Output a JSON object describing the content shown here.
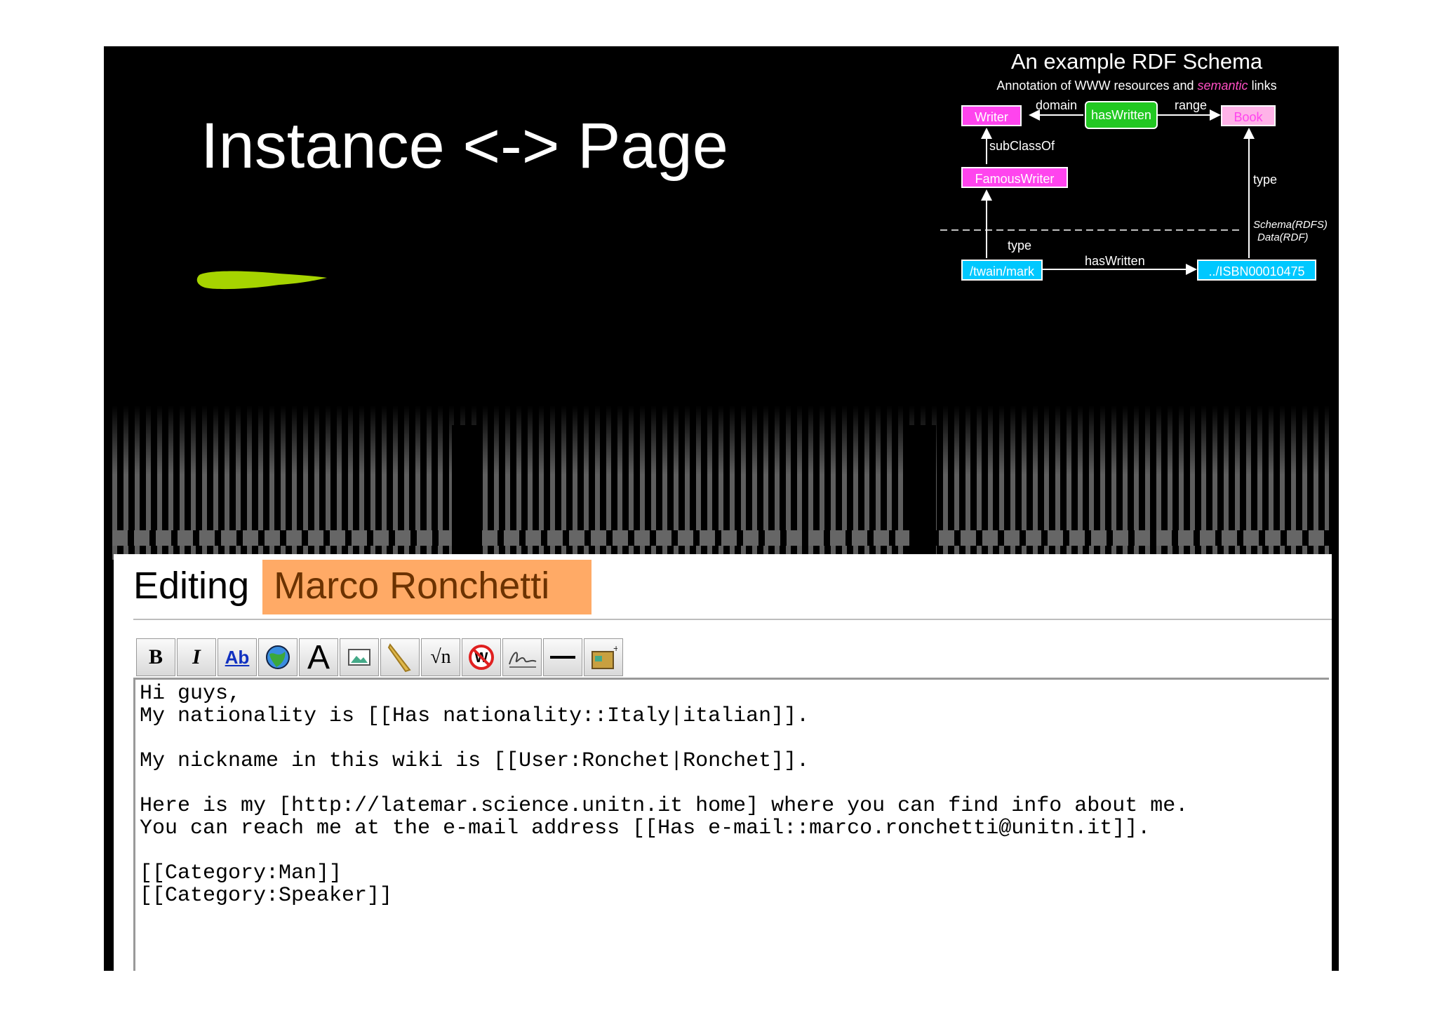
{
  "slide": {
    "title": "Instance <-> Page"
  },
  "rdf": {
    "title": "An example RDF Schema",
    "subtitle_prefix": "Annotation of WWW resources and ",
    "subtitle_semantic": "semantic",
    "subtitle_suffix": " links",
    "nodes": {
      "writer": "Writer",
      "haswritten_prop": "hasWritten",
      "book": "Book",
      "famouswriter": "FamousWriter",
      "twain": "/twain/mark",
      "isbn": "../ISBN00010475"
    },
    "edges": {
      "domain": "domain",
      "range": "range",
      "subclassof": "subClassOf",
      "type_right": "type",
      "type_left": "type",
      "haswritten": "hasWritten",
      "schema": "Schema(RDFS)",
      "data": "Data(RDF)"
    }
  },
  "editor": {
    "heading": "Editing ",
    "page_name": "Marco Ronchetti",
    "toolbar": [
      "bold",
      "italic",
      "link",
      "globe-link",
      "headline",
      "image",
      "media",
      "math",
      "nowiki",
      "signature",
      "hr",
      "insert-table"
    ],
    "lines": [
      "Hi guys,",
      "My nationality is [[Has nationality::Italy|italian]].",
      "",
      "My nickname in this wiki is [[User:Ronchet|Ronchet]].",
      "",
      "Here is my [http://latemar.science.unitn.it home] where you can find info about me.",
      "You can reach me at the e-mail address [[Has e-mail::marco.ronchetti@unitn.it]].",
      "",
      "[[Category:Man]]",
      "[[Category:Speaker]]"
    ]
  }
}
